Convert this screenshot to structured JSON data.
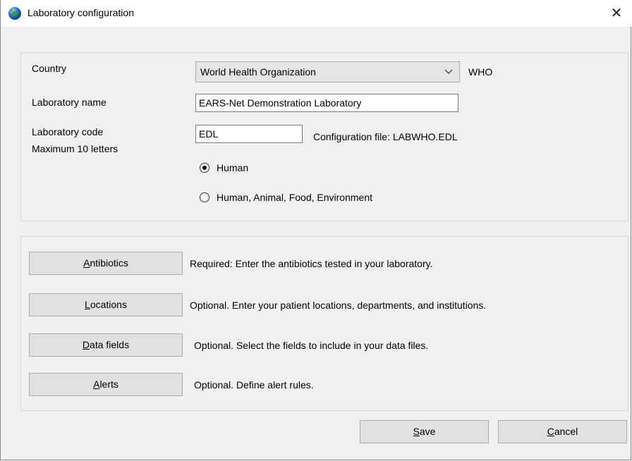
{
  "window": {
    "title": "Laboratory configuration",
    "close_glyph": "✕"
  },
  "form": {
    "country_label": "Country",
    "country_value": "World Health Organization",
    "country_code": "WHO",
    "lab_name_label": "Laboratory name",
    "lab_name_value": "EARS-Net Demonstration Laboratory",
    "lab_code_label": "Laboratory code",
    "lab_code_hint": "Maximum 10 letters",
    "lab_code_value": "EDL",
    "config_file": "Configuration file: LABWHO.EDL",
    "radio_options": [
      {
        "label": "Human",
        "checked": true
      },
      {
        "label": "Human, Animal, Food, Environment",
        "checked": false
      }
    ]
  },
  "setup": {
    "items": [
      {
        "button_mnemonic": "A",
        "button_rest": "ntibiotics",
        "description": "Required:  Enter the antibiotics tested in your laboratory."
      },
      {
        "button_mnemonic": "L",
        "button_rest": "ocations",
        "description": "Optional. Enter your patient locations, departments, and institutions."
      },
      {
        "button_mnemonic": "D",
        "button_rest": "ata fields",
        "description": "Optional. Select the fields to include in your data files."
      },
      {
        "button_mnemonic": "A",
        "button_rest": "lerts",
        "description": "Optional. Define alert rules."
      }
    ]
  },
  "footer": {
    "save_mnemonic": "S",
    "save_rest": "ave",
    "cancel_mnemonic": "C",
    "cancel_rest": "ancel"
  }
}
